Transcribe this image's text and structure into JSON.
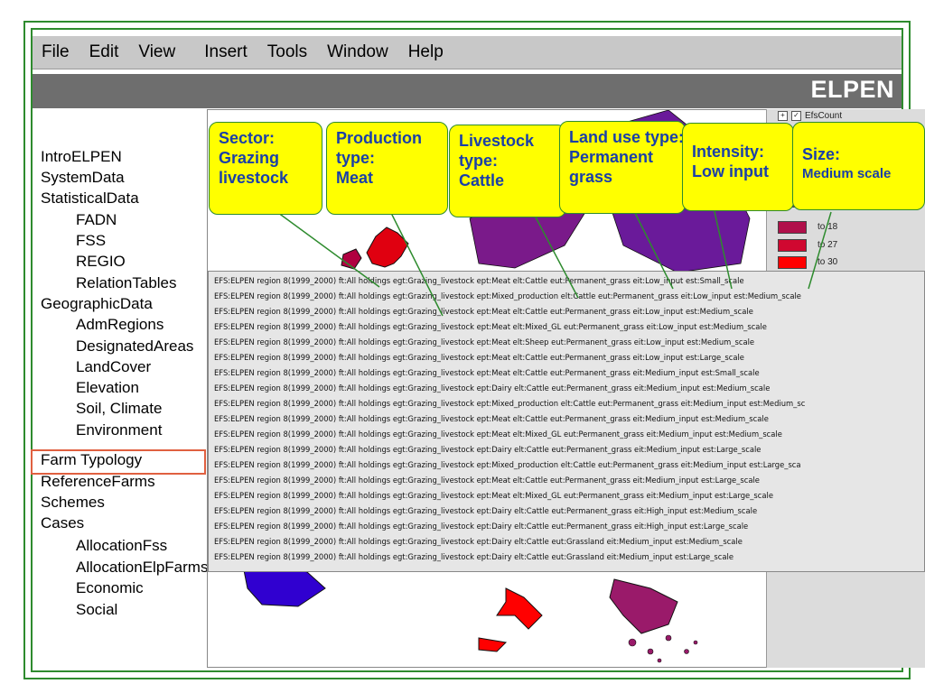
{
  "menu": [
    "File",
    "Edit",
    "View",
    "Insert",
    "Tools",
    "Window",
    "Help"
  ],
  "brand": "ELPEN",
  "sidebar": {
    "items": [
      {
        "label": "IntroELPEN",
        "level": 0
      },
      {
        "label": "SystemData",
        "level": 0
      },
      {
        "label": "StatisticalData",
        "level": 0
      },
      {
        "label": "FADN",
        "level": 1
      },
      {
        "label": "FSS",
        "level": 1
      },
      {
        "label": "REGIO",
        "level": 1
      },
      {
        "label": "RelationTables",
        "level": 1
      },
      {
        "label": "GeographicData",
        "level": 0
      },
      {
        "label": "AdmRegions",
        "level": 1
      },
      {
        "label": "DesignatedAreas",
        "level": 1
      },
      {
        "label": "LandCover",
        "level": 1
      },
      {
        "label": "Elevation",
        "level": 1
      },
      {
        "label": "Soil, Climate",
        "level": 1
      },
      {
        "label": "Environment",
        "level": 1
      },
      {
        "label": "Farm Typology",
        "level": 0
      },
      {
        "label": "ReferenceFarms",
        "level": 0
      },
      {
        "label": "Schemes",
        "level": 0
      },
      {
        "label": "Cases",
        "level": 0
      },
      {
        "label": "AllocationFss",
        "level": 1
      },
      {
        "label": "AllocationElpFarms",
        "level": 1
      },
      {
        "label": "Economic",
        "level": 1
      },
      {
        "label": "Social",
        "level": 1
      }
    ]
  },
  "callouts": [
    {
      "lines": [
        "Sector:",
        "Grazing",
        "livestock"
      ]
    },
    {
      "lines": [
        "Production",
        "type:",
        "Meat"
      ]
    },
    {
      "lines": [
        "Livestock",
        "type:",
        "Cattle"
      ]
    },
    {
      "lines": [
        "Land use type:",
        "Permanent",
        "grass"
      ]
    },
    {
      "lines": [
        "Intensity:",
        "Low input"
      ]
    },
    {
      "lines": [
        "Size:",
        "Medium scale"
      ]
    }
  ],
  "legend": {
    "header": "EfsCount",
    "rows": [
      {
        "label": "",
        "color": "#7a1a8a"
      },
      {
        "label": "",
        "color": "#8a1a70"
      },
      {
        "label": "",
        "color": "#9a1a60"
      },
      {
        "label": "to 18",
        "color": "#b0104a"
      },
      {
        "label": "to 27",
        "color": "#d00830"
      },
      {
        "label": "to 30",
        "color": "#ff0000"
      }
    ]
  },
  "records": [
    "EFS:ELPEN region 8(1999_2000) ft:All holdings egt:Grazing_livestock ept:Meat elt:Cattle eut:Permanent_grass eit:Low_input est:Small_scale",
    "EFS:ELPEN region 8(1999_2000) ft:All holdings egt:Grazing_livestock ept:Mixed_production elt:Cattle eut:Permanent_grass eit:Low_input est:Medium_scale",
    "EFS:ELPEN region 8(1999_2000) ft:All holdings egt:Grazing_livestock ept:Meat elt:Cattle eut:Permanent_grass eit:Low_input est:Medium_scale",
    "EFS:ELPEN region 8(1999_2000) ft:All holdings egt:Grazing_livestock ept:Meat elt:Mixed_GL eut:Permanent_grass eit:Low_input est:Medium_scale",
    "EFS:ELPEN region 8(1999_2000) ft:All holdings egt:Grazing_livestock ept:Meat elt:Sheep eut:Permanent_grass eit:Low_input est:Medium_scale",
    "EFS:ELPEN region 8(1999_2000) ft:All holdings egt:Grazing_livestock ept:Meat elt:Cattle eut:Permanent_grass eit:Low_input est:Large_scale",
    "EFS:ELPEN region 8(1999_2000) ft:All holdings egt:Grazing_livestock ept:Meat elt:Cattle eut:Permanent_grass eit:Medium_input est:Small_scale",
    "EFS:ELPEN region 8(1999_2000) ft:All holdings egt:Grazing_livestock ept:Dairy elt:Cattle eut:Permanent_grass eit:Medium_input est:Medium_scale",
    "EFS:ELPEN region 8(1999_2000) ft:All holdings egt:Grazing_livestock ept:Mixed_production elt:Cattle eut:Permanent_grass eit:Medium_input est:Medium_sc",
    "EFS:ELPEN region 8(1999_2000) ft:All holdings egt:Grazing_livestock ept:Meat elt:Cattle eut:Permanent_grass eit:Medium_input est:Medium_scale",
    "EFS:ELPEN region 8(1999_2000) ft:All holdings egt:Grazing_livestock ept:Meat elt:Mixed_GL eut:Permanent_grass eit:Medium_input est:Medium_scale",
    "EFS:ELPEN region 8(1999_2000) ft:All holdings egt:Grazing_livestock ept:Dairy elt:Cattle eut:Permanent_grass eit:Medium_input est:Large_scale",
    "EFS:ELPEN region 8(1999_2000) ft:All holdings egt:Grazing_livestock ept:Mixed_production elt:Cattle eut:Permanent_grass eit:Medium_input est:Large_sca",
    "EFS:ELPEN region 8(1999_2000) ft:All holdings egt:Grazing_livestock ept:Meat elt:Cattle eut:Permanent_grass eit:Medium_input est:Large_scale",
    "EFS:ELPEN region 8(1999_2000) ft:All holdings egt:Grazing_livestock ept:Meat elt:Mixed_GL eut:Permanent_grass eit:Medium_input est:Large_scale",
    "EFS:ELPEN region 8(1999_2000) ft:All holdings egt:Grazing_livestock ept:Dairy elt:Cattle eut:Permanent_grass eit:High_input est:Medium_scale",
    "EFS:ELPEN region 8(1999_2000) ft:All holdings egt:Grazing_livestock ept:Dairy elt:Cattle eut:Permanent_grass eit:High_input est:Large_scale",
    "EFS:ELPEN region 8(1999_2000) ft:All holdings egt:Grazing_livestock ept:Dairy elt:Cattle eut:Grassland eit:Medium_input est:Medium_scale",
    "EFS:ELPEN region 8(1999_2000) ft:All holdings egt:Grazing_livestock ept:Dairy elt:Cattle eut:Grassland eit:Medium_input est:Large_scale"
  ]
}
